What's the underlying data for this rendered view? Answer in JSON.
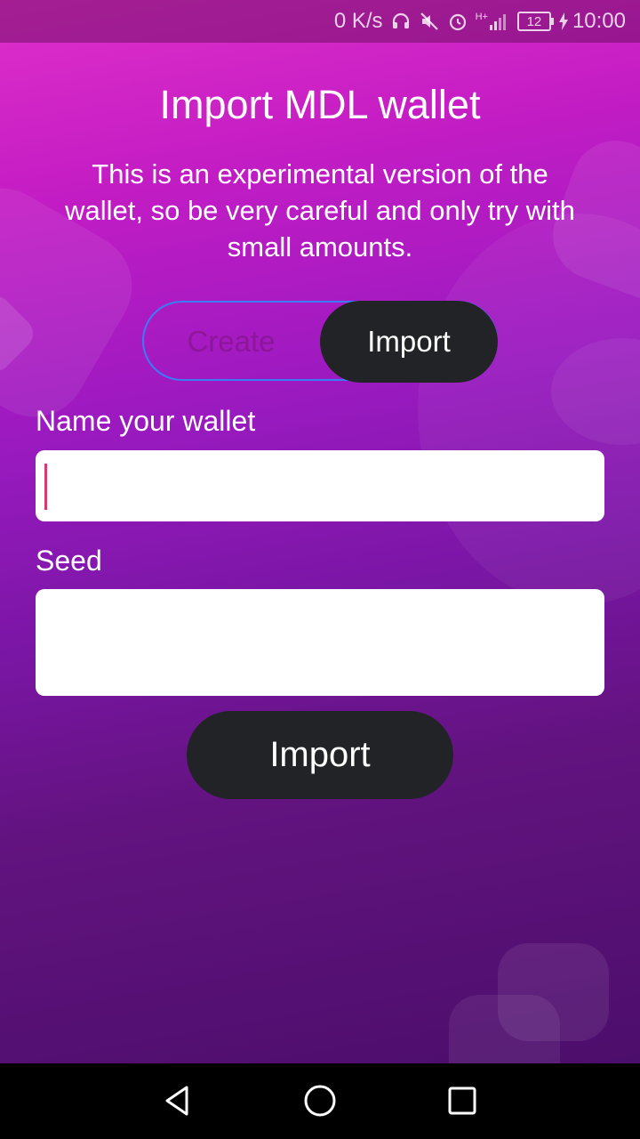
{
  "status_bar": {
    "net_speed": "0 K/s",
    "network_label": "H+",
    "battery": "12",
    "time": "10:00",
    "icons": [
      "headset-icon",
      "mute-icon",
      "alarm-icon",
      "signal-icon",
      "battery-icon",
      "charging-icon"
    ]
  },
  "page": {
    "title": "Import MDL wallet",
    "subtitle": "This is an experimental version of the wallet, so be very careful and only try with small amounts."
  },
  "toggle": {
    "create_label": "Create",
    "import_label": "Import",
    "selected": "Import"
  },
  "form": {
    "name_label": "Name your wallet",
    "name_value": "",
    "seed_label": "Seed",
    "seed_value": ""
  },
  "actions": {
    "import_button": "Import"
  },
  "colors": {
    "accent_dark": "#222326",
    "toggle_border": "#3b7cf5",
    "cursor": "#d63a6f"
  },
  "nav_bar": {
    "icons": [
      "back-icon",
      "home-icon",
      "recent-apps-icon"
    ]
  }
}
